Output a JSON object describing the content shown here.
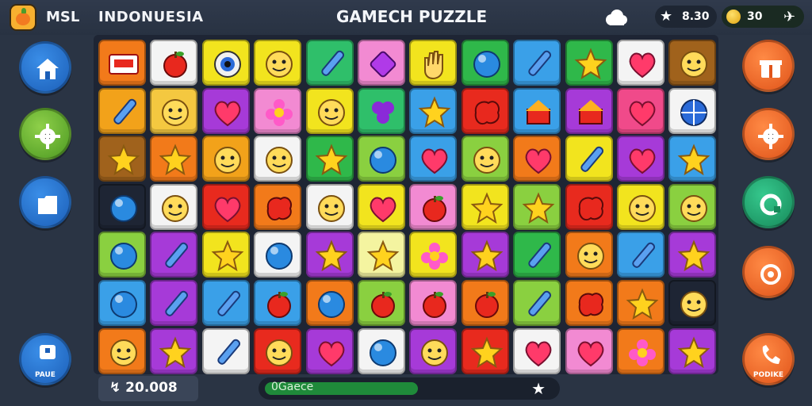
{
  "header": {
    "brand": "MSL",
    "region": "INDONUESIA",
    "title": "GAMECH PUZZLE",
    "score": "8.30",
    "coins": "30"
  },
  "left_buttons": [
    {
      "icon": "home-icon",
      "color": "blue",
      "label": ""
    },
    {
      "icon": "gear-icon",
      "color": "green",
      "label": ""
    },
    {
      "icon": "folder-icon",
      "color": "blue",
      "label": ""
    },
    {
      "icon": "pause-icon",
      "color": "blue",
      "label": "PAUE"
    }
  ],
  "right_buttons": [
    {
      "icon": "gift-icon",
      "color": "orange",
      "label": ""
    },
    {
      "icon": "gear-icon",
      "color": "orange",
      "label": ""
    },
    {
      "icon": "refresh-icon",
      "color": "teal",
      "label": ""
    },
    {
      "icon": "restart-icon",
      "color": "orange",
      "label": ""
    },
    {
      "icon": "phone-icon",
      "color": "orange",
      "label": "PODIKE"
    }
  ],
  "board": [
    [
      [
        "#f27a1a",
        "ticket"
      ],
      [
        "#f4f4f4",
        "apple"
      ],
      [
        "#f2e41e",
        "eye"
      ],
      [
        "#f2e41e",
        "face"
      ],
      [
        "#2fbf6a",
        "pen"
      ],
      [
        "#f28ad2",
        "gem"
      ],
      [
        "#f2e41e",
        "hand"
      ],
      [
        "#2fb84a",
        "ball"
      ],
      [
        "#3aa0e8",
        "pen"
      ],
      [
        "#2fb84a",
        "star"
      ],
      [
        "#f4f4f4",
        "heart"
      ],
      [
        "#a0621c",
        "face"
      ]
    ],
    [
      [
        "#f2a21a",
        "pen"
      ],
      [
        "#f4c840",
        "face"
      ],
      [
        "#a63ad8",
        "heart"
      ],
      [
        "#f28ad2",
        "flower"
      ],
      [
        "#f2e41e",
        "face"
      ],
      [
        "#2fbf6a",
        "clover"
      ],
      [
        "#3aa0e8",
        "star"
      ],
      [
        "#e82a1e",
        "blob"
      ],
      [
        "#3aa0e8",
        "house"
      ],
      [
        "#a63ad8",
        "house"
      ],
      [
        "#f04a8a",
        "heart"
      ],
      [
        "#f4f4f4",
        "globe"
      ]
    ],
    [
      [
        "#a0621c",
        "star"
      ],
      [
        "#f27a1a",
        "star"
      ],
      [
        "#f2a21a",
        "face"
      ],
      [
        "#f4f4f4",
        "face"
      ],
      [
        "#2fb84a",
        "star"
      ],
      [
        "#8ad040",
        "ball"
      ],
      [
        "#3aa0e8",
        "heart"
      ],
      [
        "#8ad040",
        "face"
      ],
      [
        "#f27a1a",
        "heart"
      ],
      [
        "#f2e41e",
        "pen"
      ],
      [
        "#a63ad8",
        "heart"
      ],
      [
        "#3aa0e8",
        "star"
      ]
    ],
    [
      [
        "#1e2534",
        "ball"
      ],
      [
        "#f4f4f4",
        "face"
      ],
      [
        "#e82a1e",
        "heart"
      ],
      [
        "#f27a1a",
        "blob"
      ],
      [
        "#f4f4f4",
        "face"
      ],
      [
        "#f2e41e",
        "heart"
      ],
      [
        "#f28ad2",
        "apple"
      ],
      [
        "#f2e41e",
        "star"
      ],
      [
        "#8ad040",
        "star"
      ],
      [
        "#e82a1e",
        "blob"
      ],
      [
        "#f2e41e",
        "face"
      ],
      [
        "#8ad040",
        "face"
      ]
    ],
    [
      [
        "#8ad040",
        "ball"
      ],
      [
        "#a63ad8",
        "pen"
      ],
      [
        "#f2e41e",
        "star"
      ],
      [
        "#f4f4f4",
        "ball"
      ],
      [
        "#a63ad8",
        "star"
      ],
      [
        "#f4f4a0",
        "star"
      ],
      [
        "#f2e41e",
        "flower"
      ],
      [
        "#a63ad8",
        "star"
      ],
      [
        "#2fb84a",
        "pen"
      ],
      [
        "#f27a1a",
        "face"
      ],
      [
        "#3aa0e8",
        "pen"
      ],
      [
        "#a63ad8",
        "star"
      ]
    ],
    [
      [
        "#3aa0e8",
        "ball"
      ],
      [
        "#a63ad8",
        "pen"
      ],
      [
        "#3aa0e8",
        "pen"
      ],
      [
        "#3aa0e8",
        "apple"
      ],
      [
        "#f27a1a",
        "ball"
      ],
      [
        "#8ad040",
        "apple"
      ],
      [
        "#f28ad2",
        "apple"
      ],
      [
        "#f27a1a",
        "apple"
      ],
      [
        "#8ad040",
        "pen"
      ],
      [
        "#f27a1a",
        "blob"
      ],
      [
        "#f27a1a",
        "star"
      ],
      [
        "#1e2534",
        "face"
      ]
    ],
    [
      [
        "#f27a1a",
        "face"
      ],
      [
        "#a63ad8",
        "star"
      ],
      [
        "#f4f4f4",
        "pen"
      ],
      [
        "#e82a1e",
        "face"
      ],
      [
        "#a63ad8",
        "heart"
      ],
      [
        "#f4f4f4",
        "ball"
      ],
      [
        "#a63ad8",
        "face"
      ],
      [
        "#e82a1e",
        "star"
      ],
      [
        "#f4f4f4",
        "heart"
      ],
      [
        "#f28ad2",
        "heart"
      ],
      [
        "#f27a1a",
        "flower"
      ],
      [
        "#a63ad8",
        "star"
      ]
    ]
  ],
  "footer": {
    "moves_label": "↯ 20.008",
    "progress_label": "0Gaece",
    "progress_value": 0.53
  }
}
